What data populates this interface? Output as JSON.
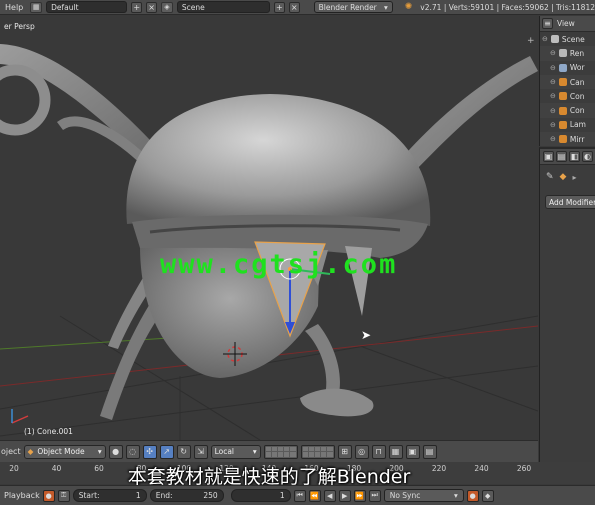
{
  "topbar": {
    "menu_help": "Help",
    "layout": "Default",
    "scene": "Scene",
    "engine": "Blender Render",
    "stats": "v2.71 | Verts:59101 | Faces:59062 | Tris:11812"
  },
  "viewport": {
    "view_label": "er Persp",
    "object_label": "(1) Cone.001",
    "watermark": "www.cgtsj.com"
  },
  "outliner": {
    "header_label": "View",
    "items": [
      {
        "label": "Scene",
        "icon_color": "#bdbdbd"
      },
      {
        "label": "Ren",
        "icon_color": "#b8b8b8"
      },
      {
        "label": "Wor",
        "icon_color": "#8fa8c8"
      },
      {
        "label": "Can",
        "icon_color": "#d8892f"
      },
      {
        "label": "Con",
        "icon_color": "#d8892f"
      },
      {
        "label": "Con",
        "icon_color": "#d8892f"
      },
      {
        "label": "Lam",
        "icon_color": "#d8892f"
      },
      {
        "label": "Mirr",
        "icon_color": "#d8892f"
      }
    ]
  },
  "properties": {
    "add_modifier": "Add Modifier"
  },
  "view_header": {
    "menu_object": "oject",
    "mode": "Object Mode",
    "orientation": "Local"
  },
  "timeline": {
    "ticks": [
      "20",
      "40",
      "60",
      "80",
      "100",
      "120",
      "140",
      "160",
      "180",
      "200",
      "220",
      "240",
      "260"
    ]
  },
  "subtitle": "本套教材就是快速的了解Blender",
  "playbar": {
    "menu_playback": "Playback",
    "start_label": "Start:",
    "start_value": "1",
    "end_label": "End:",
    "end_value": "250",
    "current_frame": "1",
    "sync": "No Sync"
  },
  "colors": {
    "accent_blue": "#5680c2",
    "watermark_green": "#1fe11f",
    "selection_orange": "#e8a24a"
  }
}
